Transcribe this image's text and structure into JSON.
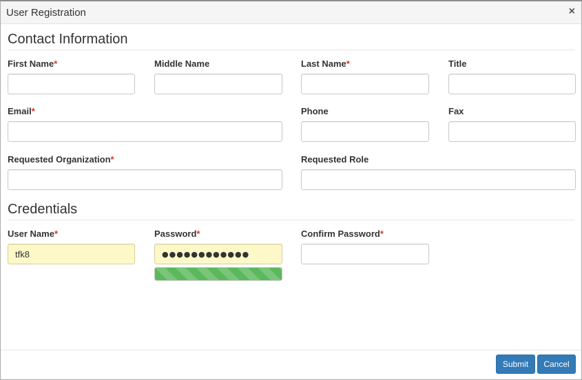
{
  "dialog": {
    "title": "User Registration",
    "close_glyph": "×"
  },
  "contact": {
    "heading": "Contact Information",
    "first_name": {
      "label": "First Name",
      "required": "*",
      "value": ""
    },
    "middle_name": {
      "label": "Middle Name",
      "value": ""
    },
    "last_name": {
      "label": "Last Name",
      "required": "*",
      "value": ""
    },
    "title": {
      "label": "Title",
      "value": ""
    },
    "email": {
      "label": "Email",
      "required": "*",
      "value": ""
    },
    "phone": {
      "label": "Phone",
      "value": ""
    },
    "fax": {
      "label": "Fax",
      "value": ""
    },
    "requested_organization": {
      "label": "Requested Organization",
      "required": "*",
      "value": ""
    },
    "requested_role": {
      "label": "Requested Role",
      "value": ""
    }
  },
  "credentials": {
    "heading": "Credentials",
    "user_name": {
      "label": "User Name",
      "required": "*",
      "value": "tfk8"
    },
    "password": {
      "label": "Password",
      "required": "*",
      "value": "●●●●●●●●●●●●",
      "strength_fraction": 1.0
    },
    "confirm_password": {
      "label": "Confirm Password",
      "required": "*",
      "value": ""
    }
  },
  "footer": {
    "submit_label": "Submit",
    "cancel_label": "Cancel"
  },
  "colors": {
    "primary_button": "#337ab7",
    "required_marker": "#d9332b",
    "autofill_background": "#fdf8c8",
    "strength_bar": "#5cb85c"
  }
}
